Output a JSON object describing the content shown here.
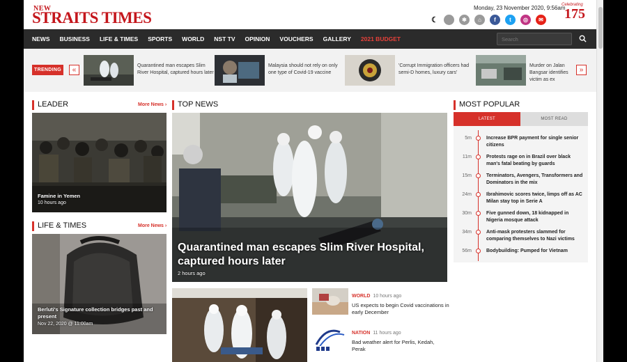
{
  "header": {
    "logo_new": "NEW",
    "logo_main": "STRAITS TIMES",
    "date": "Monday, 23 November 2020, 9:56am",
    "anniversary_script": "Celebrating",
    "anniversary_number": "175"
  },
  "nav": {
    "items": [
      "NEWS",
      "BUSINESS",
      "LIFE & TIMES",
      "SPORTS",
      "WORLD",
      "NST TV",
      "OPINION",
      "VOUCHERS",
      "GALLERY",
      "2021 BUDGET"
    ],
    "search_placeholder": "Search"
  },
  "trending": {
    "label": "TRENDING",
    "prev": "«",
    "next": "»",
    "items": [
      {
        "text": "Quarantined man escapes Slim River Hospital, captured hours later"
      },
      {
        "text": "Malaysia should not rely on only one type of Covid-19 vaccine"
      },
      {
        "text": "'Corrupt Immigration officers had semi-D homes, luxury cars'"
      },
      {
        "text": "Murder on Jalan Bangsar identifies victim as ex"
      }
    ]
  },
  "leader": {
    "title": "LEADER",
    "more": "More News ›",
    "caption": "Famine in Yemen",
    "time": "10 hours ago"
  },
  "life": {
    "title": "LIFE & TIMES",
    "more": "More News ›",
    "caption": "Berluti's Signature collection bridges past and present",
    "time": "Nov 22, 2020 @ 11:00am"
  },
  "top_news": {
    "title": "TOP NEWS",
    "hero_caption": "Quarantined man escapes Slim River Hospital, captured hours later",
    "hero_time": "2 hours ago",
    "side": [
      {
        "cat": "WORLD",
        "time": "10 hours ago",
        "title": "US expects to begin Covid vaccinations in early December"
      },
      {
        "cat": "NATION",
        "time": "11 hours ago",
        "title": "Bad weather alert for Perlis, Kedah, Perak"
      }
    ]
  },
  "most_popular": {
    "title": "MOST POPULAR",
    "tabs": [
      "LATEST",
      "MOST READ"
    ],
    "items": [
      {
        "time": "5m",
        "text": "Increase BPR payment for single senior citizens"
      },
      {
        "time": "11m",
        "text": "Protests rage on in Brazil over black man's fatal beating by guards"
      },
      {
        "time": "15m",
        "text": "Terminators, Avengers, Transformers and Dominators in the mix"
      },
      {
        "time": "24m",
        "text": "Ibrahimovic scores twice, limps off as AC Milan stay top in Serie A"
      },
      {
        "time": "30m",
        "text": "Five gunned down, 18 kidnapped in Nigeria mosque attack"
      },
      {
        "time": "34m",
        "text": "Anti-mask protesters slammed for comparing themselves to Nazi victims"
      },
      {
        "time": "56m",
        "text": "Bodybuilding: Pumped for Vietnam"
      }
    ]
  },
  "colors": {
    "accent": "#d6312a",
    "nav_bg": "#2b2b2b",
    "brand": "#c4161c"
  }
}
